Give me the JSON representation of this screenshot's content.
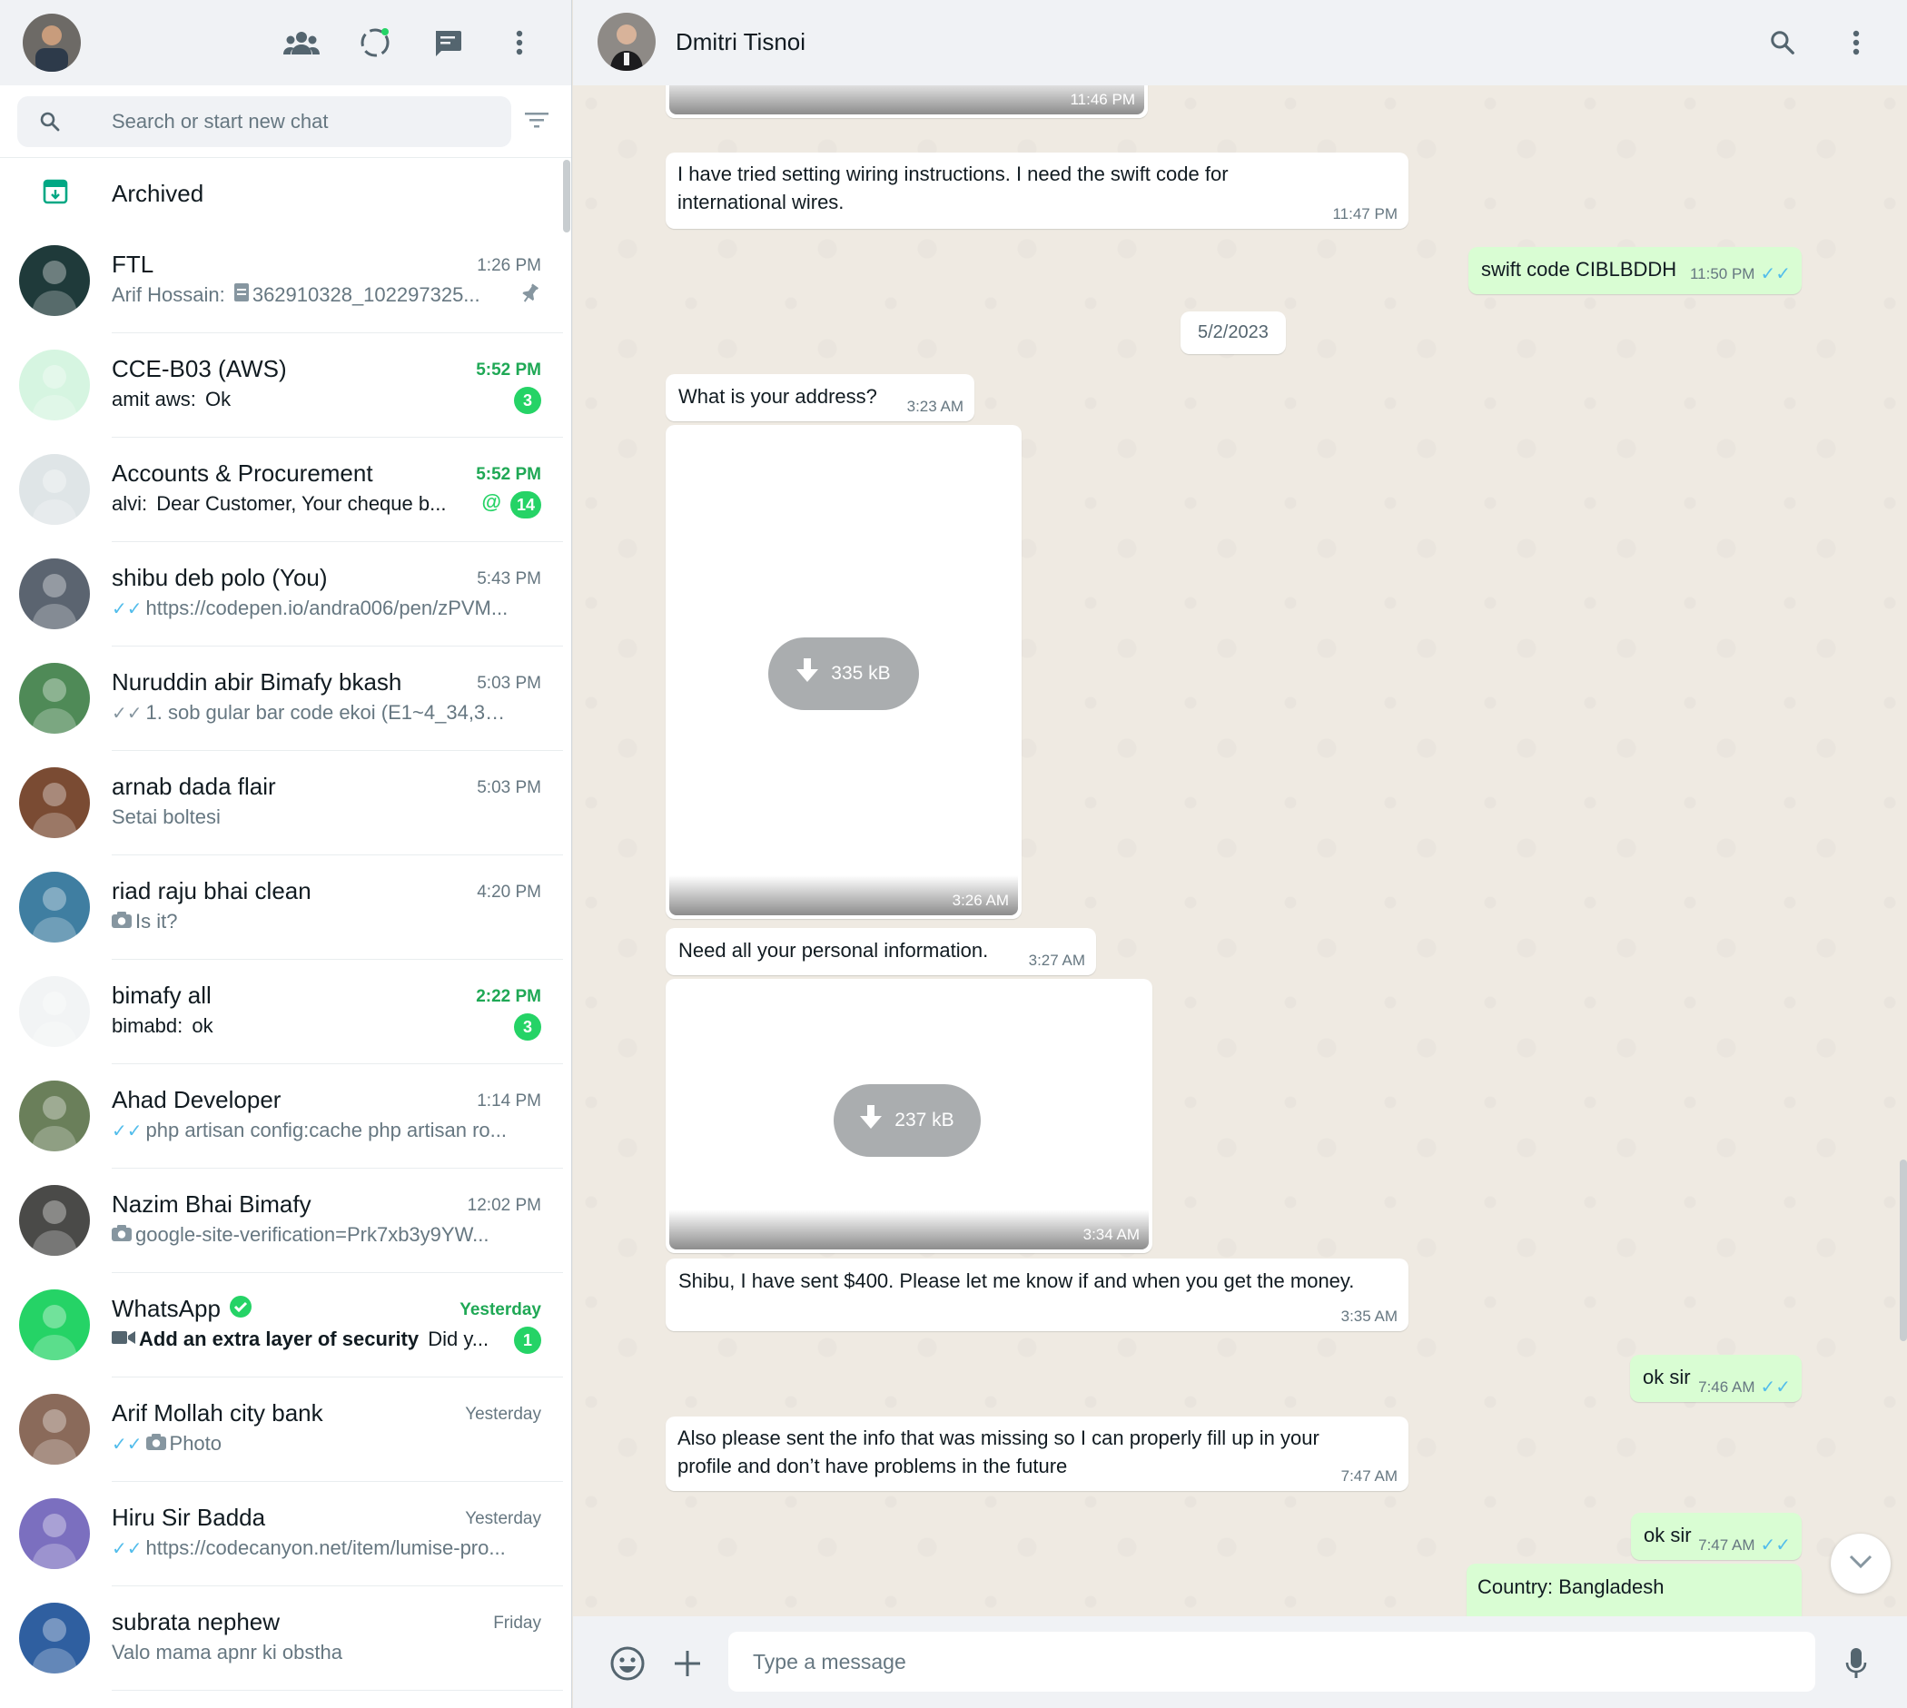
{
  "left_header": {
    "icons": [
      "communities-icon",
      "status-icon",
      "new-chat-icon",
      "menu-icon"
    ]
  },
  "search": {
    "placeholder": "Search or start new chat"
  },
  "archived": {
    "label": "Archived"
  },
  "chats": [
    {
      "name": "FTL",
      "time": "1:26 PM",
      "preview_prefix": "Arif Hossain: ",
      "preview": "362910328_102297325...",
      "pinned": true,
      "avatar_color": "#1f3a3a"
    },
    {
      "name": "CCE-B03 (AWS)",
      "time": "5:52 PM",
      "preview_prefix": "amit aws: ",
      "preview": "Ok",
      "unread": "3",
      "avatar_color": "#d6f5e1"
    },
    {
      "name": "Accounts & Procurement",
      "time": "5:52 PM",
      "preview_prefix": "alvi: ",
      "preview": "Dear Customer, Your cheque b...",
      "unread": "14",
      "mention": "@",
      "avatar_color": "#dfe5e7"
    },
    {
      "name": "shibu deb polo (You)",
      "time": "5:43 PM",
      "preview": "https://codepen.io/andra006/pen/zPVM...",
      "ticks": "blue",
      "avatar_color": "#5b6470"
    },
    {
      "name": "Nuruddin abir Bimafy bkash",
      "time": "5:03 PM",
      "preview": "1. sob gular bar code ekoi (E1~4_34,310...",
      "ticks": "grey",
      "avatar_color": "#4f8a57"
    },
    {
      "name": "arnab dada flair",
      "time": "5:03 PM",
      "preview": "Setai boltesi",
      "avatar_color": "#7a4b33"
    },
    {
      "name": "riad raju bhai clean",
      "time": "4:20 PM",
      "preview": "Is it?",
      "camera": true,
      "avatar_color": "#3f7ea1"
    },
    {
      "name": "bimafy all",
      "time": "2:22 PM",
      "preview_prefix": "bimabd: ",
      "preview": "ok",
      "unread": "3",
      "avatar_color": "#f2f4f5"
    },
    {
      "name": "Ahad Developer",
      "time": "1:14 PM",
      "preview": "php artisan config:cache php artisan ro...",
      "ticks": "blue",
      "avatar_color": "#6a7f5a"
    },
    {
      "name": "Nazim Bhai Bimafy",
      "time": "12:02 PM",
      "preview": "google-site-verification=Prk7xb3y9YW...",
      "camera": true,
      "avatar_color": "#4a4a48"
    },
    {
      "name": "WhatsApp",
      "time": "Yesterday",
      "preview_bold": "Add an extra layer of security",
      "preview": " Did y...",
      "unread": "1",
      "verified": true,
      "video": true,
      "avatar_color": "#25d366"
    },
    {
      "name": "Arif Mollah city bank",
      "time": "Yesterday",
      "preview": "Photo",
      "ticks": "blue",
      "camera": true,
      "avatar_color": "#8a6a5a"
    },
    {
      "name": "Hiru Sir Badda",
      "time": "Yesterday",
      "preview": "https://codecanyon.net/item/lumise-pro...",
      "ticks": "blue",
      "avatar_color": "#7b6fbf"
    },
    {
      "name": "subrata nephew",
      "time": "Friday",
      "preview": "Valo mama apnr ki obstha",
      "avatar_color": "#2f5fa0"
    }
  ],
  "conversation": {
    "contact_name": "Dmitri Tisnoi",
    "messages": [
      {
        "type": "image",
        "dir": "in",
        "time": "11:46 PM"
      },
      {
        "type": "text",
        "dir": "in",
        "text_lines": [
          "I have tried setting wiring instructions. I need the swift code for",
          "international wires."
        ],
        "time": "11:47 PM"
      },
      {
        "type": "text",
        "dir": "out",
        "text": "swift code CIBLBDDH",
        "time": "11:50 PM"
      },
      {
        "type": "date",
        "text": "5/2/2023"
      },
      {
        "type": "text",
        "dir": "in",
        "text": "What is your address?",
        "time": "3:23 AM"
      },
      {
        "type": "image",
        "dir": "in",
        "size": "335 kB",
        "time": "3:26 AM"
      },
      {
        "type": "text",
        "dir": "in",
        "text": "Need all your personal information.",
        "time": "3:27 AM"
      },
      {
        "type": "image",
        "dir": "in",
        "size": "237 kB",
        "time": "3:34 AM"
      },
      {
        "type": "text",
        "dir": "in",
        "text": "Shibu, I have sent $400. Please let me know if and when you get the money.",
        "time": "3:35 AM"
      },
      {
        "type": "text",
        "dir": "out",
        "text": "ok sir",
        "time": "7:46 AM"
      },
      {
        "type": "text",
        "dir": "in",
        "text_lines": [
          "Also please sent the info that was missing so I can properly fill up in your",
          "profile and don’t have problems in the future"
        ],
        "time": "7:47 AM"
      },
      {
        "type": "text",
        "dir": "out",
        "text": "ok sir",
        "time": "7:47 AM"
      },
      {
        "type": "text",
        "dir": "out",
        "text": "Country: Bangladesh"
      }
    ]
  },
  "composer": {
    "placeholder": "Type a message"
  },
  "colors": {
    "accent": "#25d366",
    "unread_time": "#1fa855",
    "outgoing_bubble": "#d9fdd3",
    "read_ticks": "#53bdeb",
    "header_bg": "#f0f2f5"
  }
}
